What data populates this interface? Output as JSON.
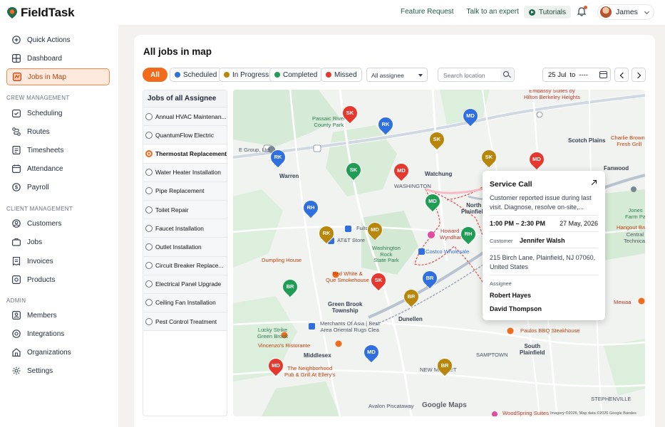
{
  "app": {
    "name": "FieldTask"
  },
  "header": {
    "links": [
      "Feature Request",
      "Talk to an expert"
    ],
    "tutorials": "Tutorials",
    "user": "James"
  },
  "sidebar": {
    "top_items": [
      {
        "label": "Quick Actions",
        "icon": "plus-circle-icon"
      },
      {
        "label": "Dashboard",
        "icon": "dashboard-grid-icon"
      },
      {
        "label": "Jobs in Map",
        "icon": "map-icon",
        "active": true
      }
    ],
    "sections": [
      {
        "title": "CREW MANAGEMENT",
        "items": [
          {
            "label": "Scheduling",
            "icon": "calendar-check-icon"
          },
          {
            "label": "Routes",
            "icon": "route-icon"
          },
          {
            "label": "Timesheets",
            "icon": "timesheet-icon"
          },
          {
            "label": "Attendance",
            "icon": "attendance-calendar-icon"
          },
          {
            "label": "Payroll",
            "icon": "dollar-icon"
          }
        ]
      },
      {
        "title": "CLIENT MANAGEMENT",
        "items": [
          {
            "label": "Customers",
            "icon": "user-icon"
          },
          {
            "label": "Jobs",
            "icon": "briefcase-icon"
          },
          {
            "label": "Invoices",
            "icon": "invoice-icon"
          },
          {
            "label": "Products",
            "icon": "box-icon"
          }
        ]
      },
      {
        "title": "ADMIN",
        "items": [
          {
            "label": "Members",
            "icon": "members-icon"
          },
          {
            "label": "Integrations",
            "icon": "integrations-icon"
          },
          {
            "label": "Organizations",
            "icon": "building-icon"
          },
          {
            "label": "Settings",
            "icon": "gear-icon"
          }
        ]
      }
    ]
  },
  "page": {
    "title": "All jobs in map"
  },
  "filters": {
    "all": "All",
    "statuses": [
      {
        "label": "Scheduled",
        "color": "#2f6fe0"
      },
      {
        "label": "In Progress",
        "color": "#b8860b"
      },
      {
        "label": "Completed",
        "color": "#1f9d55"
      },
      {
        "label": "Missed",
        "color": "#e5392f"
      }
    ],
    "assignee": "All assignee",
    "search_placeholder": "Search location",
    "date_from": "25 Jul",
    "date_to_label": "to",
    "date_to": "----"
  },
  "joblist": {
    "header": "Jobs of all Assignee",
    "items": [
      "Annual HVAC Maintenan...",
      "QuantumFlow Electric",
      "Thermostat Replacement",
      "Water Heater Installation",
      "Pipe Replacement",
      "Toilet Repair",
      "Faucet Installation",
      "Outlet Installation",
      "Circuit Breaker Replace...",
      "Electrical Panel Upgrade",
      "Ceiling Fan Installation",
      "Pest Control Treatment"
    ],
    "selected_index": 2
  },
  "map": {
    "labels": {
      "passaic": "Passaic River\nCounty Park",
      "embassy": "Embassy Suites by\nHilton Berkeley Heights",
      "scotch": "Scotch Plains",
      "charlie": "Charlie Browns\nFresh Grill",
      "fanwood": "Fanwood",
      "group": "E Group, Ltd",
      "warren": "Warren",
      "watchung": "Watchung",
      "washington": "WASHINGTON",
      "north_plainfield": "North\nPlainfield",
      "fulton": "Fulton",
      "att": "AT&T Store",
      "wrsp": "Washington\nRock\nState Park",
      "howard": "Howard J\nWyndham",
      "costco": "Costco Wholesale",
      "dumpling": "Dumpling House",
      "redwhite": "Red White &\nQue Smokehouse",
      "greenbrook": "Green Brook\nTownship",
      "dunellen": "Dunellen",
      "lucky": "Lucky Strike\nGreen Brook",
      "merchants": "Merchants Of Asia | Best\nArea Oriental Rugs Clea",
      "vincenzo": "Vincenzo's Ristorante",
      "middlesex": "Middlesex",
      "neighborhood": "The Neighborhood\nPub & Grill At Ellery's",
      "newmarket": "NEW MARKET",
      "sampton": "SAMPTOWN",
      "south_plainfield": "South\nPlainfield",
      "paulos": "Paulos BBQ Steakhouse",
      "avalon": "Avalon Piscataway",
      "stephenville": "STEPHENVILLE",
      "jones": "Jones\nFarm Pa",
      "hangout": "Hangout Bar",
      "central": "Central\nTechnical",
      "mewaa": "Mewaa",
      "woodspring": "WoodSpring Suites"
    },
    "google": "Google Maps",
    "attribution": "Imagery ©2026, Map data ©2026 Google   Bandes",
    "pins": [
      {
        "initials": "SK",
        "color": "#e5392f"
      },
      {
        "initials": "MD",
        "color": "#2f6fe0"
      },
      {
        "initials": "RK",
        "color": "#2f6fe0"
      },
      {
        "initials": "SK",
        "color": "#b8860b"
      },
      {
        "initials": "SK",
        "color": "#b8860b"
      },
      {
        "initials": "MD",
        "color": "#e5392f"
      },
      {
        "initials": "RK",
        "color": "#2f6fe0"
      },
      {
        "initials": "SK",
        "color": "#1f9d55"
      },
      {
        "initials": "MD",
        "color": "#e5392f"
      },
      {
        "initials": "MD",
        "color": "#1f9d55"
      },
      {
        "initials": "RH",
        "color": "#2f6fe0"
      },
      {
        "initials": "RK",
        "color": "#b8860b"
      },
      {
        "initials": "MD",
        "color": "#b8860b"
      },
      {
        "initials": "RH",
        "color": "#1f9d55"
      },
      {
        "initials": "BR",
        "color": "#1f9d55"
      },
      {
        "initials": "SK",
        "color": "#e5392f"
      },
      {
        "initials": "BR",
        "color": "#2f6fe0"
      },
      {
        "initials": "BR",
        "color": "#b8860b"
      },
      {
        "initials": "MD",
        "color": "#2f6fe0"
      },
      {
        "initials": "MD",
        "color": "#e5392f"
      },
      {
        "initials": "BR",
        "color": "#b8860b"
      }
    ]
  },
  "popup": {
    "title": "Service Call",
    "description": "Customer reported issue during last visit. Diagnose, resolve on-site,...",
    "time": "1:00 PM – 2:30 PM",
    "date": "27 May, 2026",
    "customer_label": "Customer",
    "customer": "Jennifer Walsh",
    "address": "215 Birch Lane, Plainfield, NJ 07060, United States",
    "assignee_label": "Assignee",
    "assignees": [
      "Robert Hayes",
      "David Thompson"
    ]
  }
}
